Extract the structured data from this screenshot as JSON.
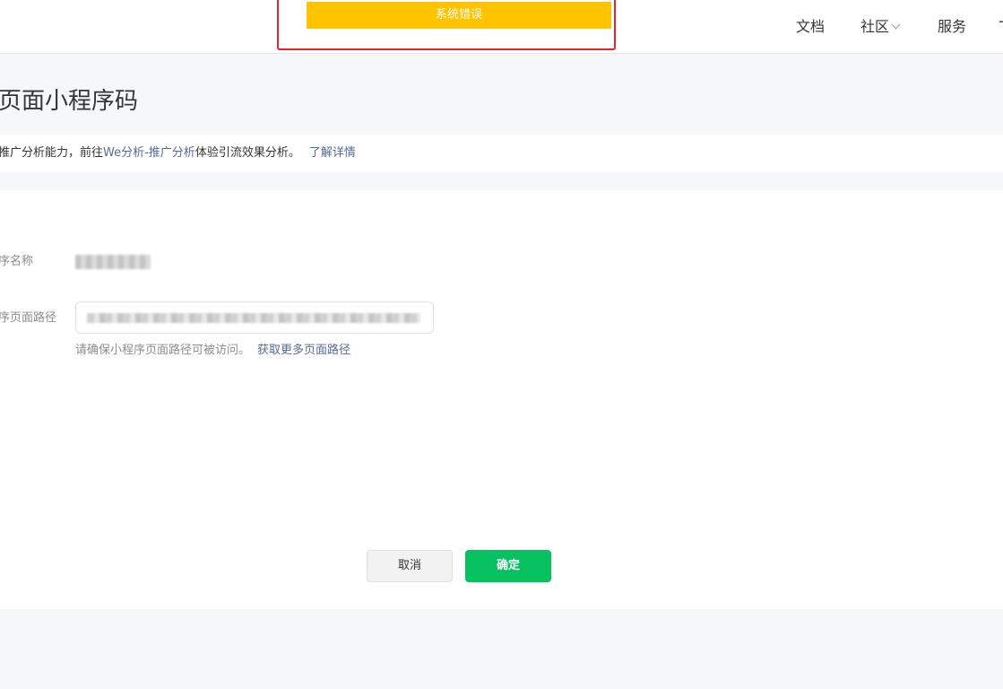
{
  "toast": {
    "message": "系统错误",
    "color": "#ffc300",
    "highlight_color": "#e8222a"
  },
  "nav": {
    "docs": "文档",
    "community": "社区",
    "service": "服务",
    "more": "T"
  },
  "page": {
    "title": "页面小程序码"
  },
  "notice": {
    "prefix": "推广分析能力，前往",
    "link": "We分析-推广分析",
    "suffix": "体验引流效果分析。",
    "learn_more": "了解详情"
  },
  "form": {
    "name_label": "序名称",
    "path_label": "序页面路径",
    "hint": "请确保小程序页面路径可被访问。",
    "hint_link": "获取更多页面路径"
  },
  "actions": {
    "cancel": "取消",
    "confirm": "确定",
    "confirm_color": "#07c160"
  }
}
